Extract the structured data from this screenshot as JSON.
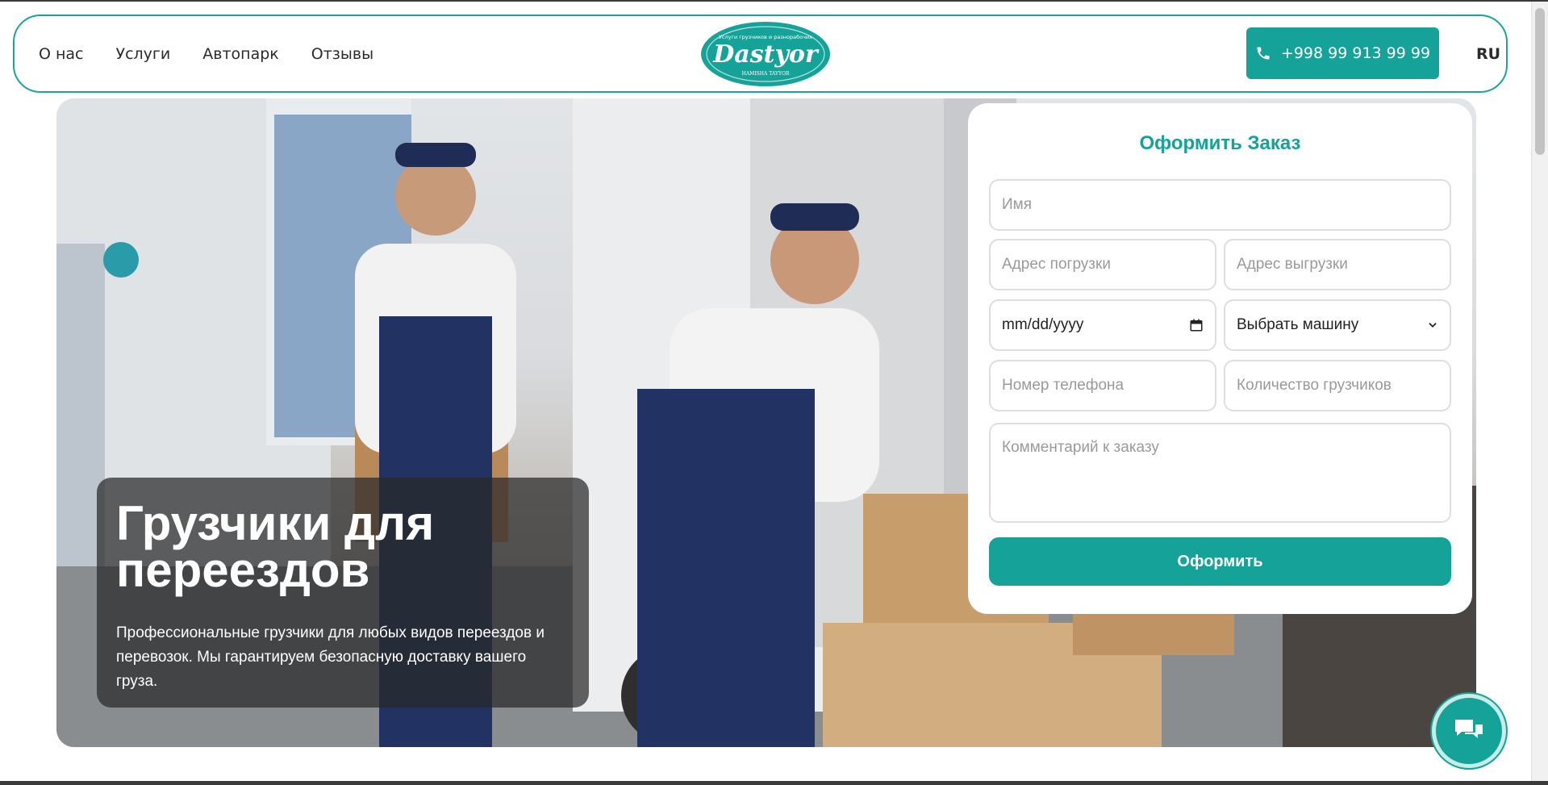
{
  "header": {
    "nav": [
      "О нас",
      "Услуги",
      "Автопарк",
      "Отзывы"
    ],
    "logo": {
      "name": "Dastyor",
      "tagline": "Услуги грузчиков и разнорабочих",
      "sub": "HAMISHA  TAYYOR"
    },
    "phone": "+998 99 913 99 99",
    "lang": "RU"
  },
  "hero": {
    "title": "Грузчики для переездов",
    "description": "Профессиональные грузчики для любых видов переездов и перевозок. Мы гарантируем безопасную доставку вашего груза."
  },
  "order_form": {
    "title": "Оформить Заказ",
    "name_placeholder": "Имя",
    "load_address_placeholder": "Адрес погрузки",
    "unload_address_placeholder": "Адрес выгрузки",
    "date_placeholder": "mm/dd/yyyy",
    "vehicle_select": "Выбрать машину",
    "phone_placeholder": "Номер телефона",
    "movers_count_placeholder": "Количество грузчиков",
    "comment_placeholder": "Комментарий к заказу",
    "submit": "Оформить"
  },
  "colors": {
    "accent": "#15a298",
    "text": "#2b2b2b"
  },
  "icons": [
    "phone-icon",
    "calendar-icon",
    "chevron-down-icon",
    "chat-icon"
  ]
}
